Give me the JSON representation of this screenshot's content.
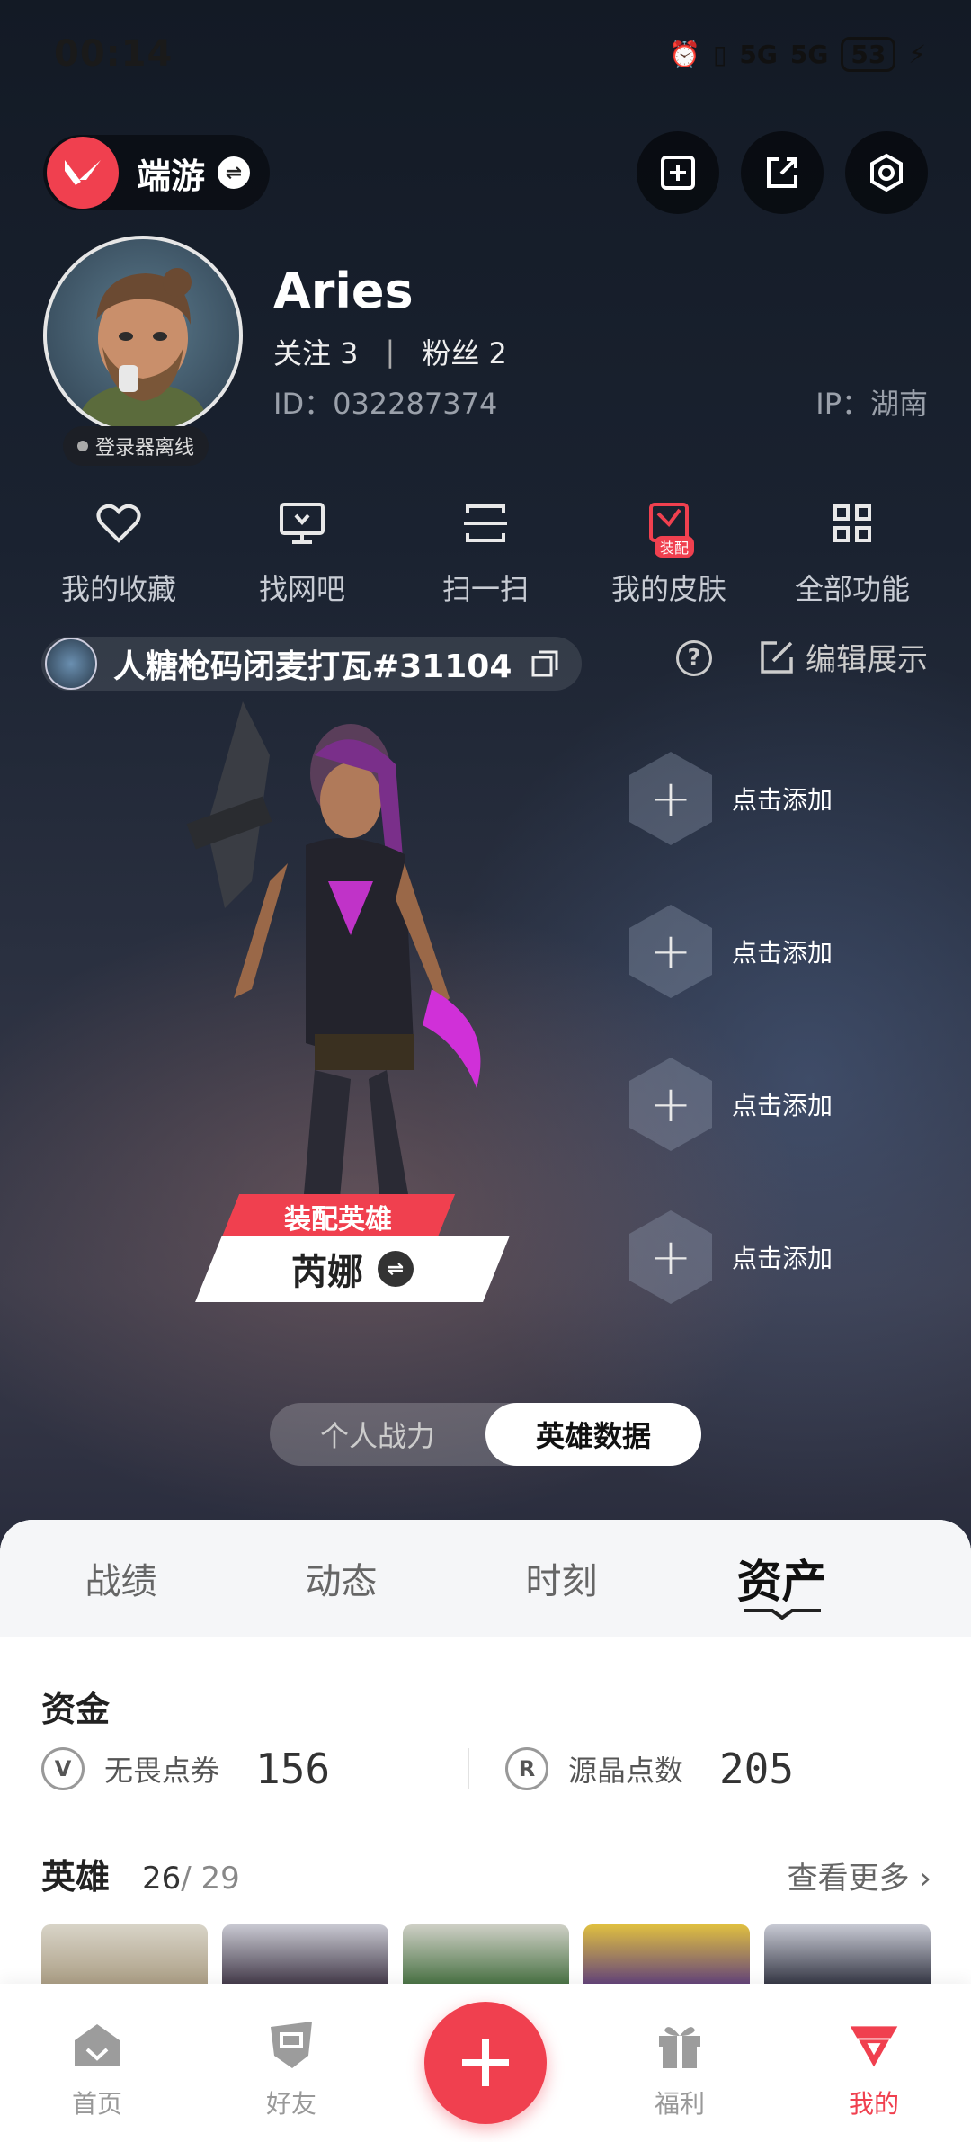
{
  "status_bar": {
    "time": "00:14",
    "battery": "53",
    "signal_1": "5G",
    "signal_2": "5G"
  },
  "header": {
    "game_name": "端游"
  },
  "profile": {
    "username": "Aries",
    "following_label": "关注 3",
    "followers_label": "粉丝 2",
    "separator": "|",
    "id_text": "ID：032287374",
    "ip_text": "IP：湖南",
    "status_badge": "登录器离线"
  },
  "quick_nav": [
    {
      "label": "我的收藏",
      "icon": "heart-icon"
    },
    {
      "label": "找网吧",
      "icon": "monitor-icon"
    },
    {
      "label": "扫一扫",
      "icon": "scan-icon"
    },
    {
      "label": "我的皮肤",
      "icon": "skin-icon",
      "badge": "装配"
    },
    {
      "label": "全部功能",
      "icon": "grid-icon"
    }
  ],
  "riot": {
    "name": "人糖枪码闭麦打瓦#31104"
  },
  "edit_display_label": "编辑展示",
  "help_label": "?",
  "hero": {
    "tag": "装配英雄",
    "name": "芮娜"
  },
  "add_slots": [
    {
      "label": "点击添加"
    },
    {
      "label": "点击添加"
    },
    {
      "label": "点击添加"
    },
    {
      "label": "点击添加"
    }
  ],
  "segmented": {
    "left": "个人战力",
    "right": "英雄数据"
  },
  "tabs": [
    {
      "label": "战绩"
    },
    {
      "label": "动态"
    },
    {
      "label": "时刻"
    },
    {
      "label": "资产"
    }
  ],
  "assets": {
    "funds_title": "资金",
    "currency_1": {
      "label": "无畏点券",
      "value": "156"
    },
    "currency_2": {
      "label": "源晶点数",
      "value": "205"
    },
    "heroes_title": "英雄",
    "heroes_owned": "26",
    "heroes_total": "/ 29",
    "see_more": "查看更多 ›"
  },
  "bottom_nav": [
    {
      "label": "首页"
    },
    {
      "label": "好友"
    },
    {
      "label": "福利"
    },
    {
      "label": "我的"
    }
  ],
  "colors": {
    "accent": "#f0404f",
    "sheet_bg": "#ffffff",
    "tab_bg": "#f5f6f8"
  }
}
